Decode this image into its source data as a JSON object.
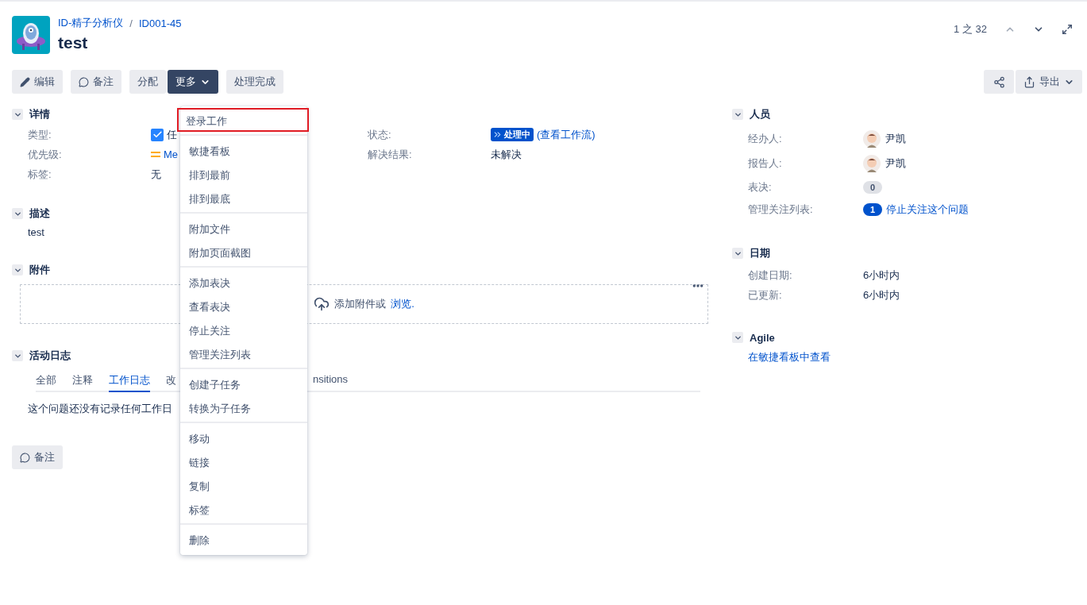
{
  "breadcrumbs": [
    "ID-精子分析仪",
    "ID001-45"
  ],
  "breadcrumb_separator": "/",
  "title": "test",
  "pager": {
    "text": "1 之 32"
  },
  "toolbar": [
    {
      "label": "编辑",
      "kind": "edit"
    },
    {
      "label": "备注",
      "kind": "comment"
    },
    {
      "label": "分配",
      "kind": "plain"
    },
    {
      "label": "更多",
      "kind": "dropdown",
      "selected": true
    },
    {
      "label": "处理完成",
      "kind": "plain"
    }
  ],
  "export_button": {
    "label": "导出"
  },
  "details": {
    "title": "详情",
    "left": [
      {
        "label": "类型:",
        "value": "任",
        "kind": "type"
      },
      {
        "label": "优先级:",
        "value": "Me",
        "kind": "priority"
      },
      {
        "label": "标签:",
        "value": "无",
        "kind": "text"
      }
    ],
    "right": [
      {
        "label": "状态:",
        "value": "处理中",
        "link": "(查看工作流)",
        "kind": "status"
      },
      {
        "label": "解决结果:",
        "value": "未解决",
        "kind": "text"
      }
    ]
  },
  "description": {
    "title": "描述",
    "text": "test"
  },
  "attachments": {
    "title": "附件",
    "drop_text": "添加附件或",
    "browse_link": "浏览."
  },
  "activity": {
    "title": "活动日志",
    "tabs": [
      {
        "label": "全部",
        "selected": false
      },
      {
        "label": "注释",
        "selected": false
      },
      {
        "label": "工作日志",
        "selected": true
      },
      {
        "label": "改",
        "selected": false
      },
      {
        "label": "nsitions",
        "selected": false
      }
    ],
    "empty_text": "这个问题还没有记录任何工作日"
  },
  "comment_button": {
    "label": "备注"
  },
  "people": {
    "title": "人员",
    "rows": [
      {
        "label": "经办人:",
        "value": "尹凯",
        "kind": "user"
      },
      {
        "label": "报告人:",
        "value": "尹凯",
        "kind": "user"
      },
      {
        "label": "表决:",
        "value": "0",
        "kind": "count"
      },
      {
        "label": "管理关注列表:",
        "value": "1",
        "link": "停止关注这个问题",
        "kind": "watch"
      }
    ]
  },
  "dates": {
    "title": "日期",
    "rows": [
      {
        "label": "创建日期:",
        "value": "6小时内"
      },
      {
        "label": "已更新:",
        "value": "6小时内"
      }
    ]
  },
  "agile": {
    "title": "Agile",
    "link": "在敏捷看板中查看"
  },
  "menu": {
    "groups": [
      [
        {
          "label": "登录工作",
          "selected": true
        }
      ],
      [
        {
          "label": "敏捷看板",
          "selected": false
        },
        {
          "label": "排到最前",
          "selected": false
        },
        {
          "label": "排到最底",
          "selected": false
        }
      ],
      [
        {
          "label": "附加文件",
          "selected": false
        },
        {
          "label": "附加页面截图",
          "selected": false
        }
      ],
      [
        {
          "label": "添加表决",
          "selected": false
        },
        {
          "label": "查看表决",
          "selected": false
        },
        {
          "label": "停止关注",
          "selected": false
        },
        {
          "label": "管理关注列表",
          "selected": false
        }
      ],
      [
        {
          "label": "创建子任务",
          "selected": false
        },
        {
          "label": "转换为子任务",
          "selected": false
        }
      ],
      [
        {
          "label": "移动",
          "selected": false
        },
        {
          "label": "链接",
          "selected": false
        },
        {
          "label": "复制",
          "selected": false
        },
        {
          "label": "标签",
          "selected": false
        }
      ],
      [
        {
          "label": "删除",
          "selected": false
        }
      ]
    ]
  }
}
